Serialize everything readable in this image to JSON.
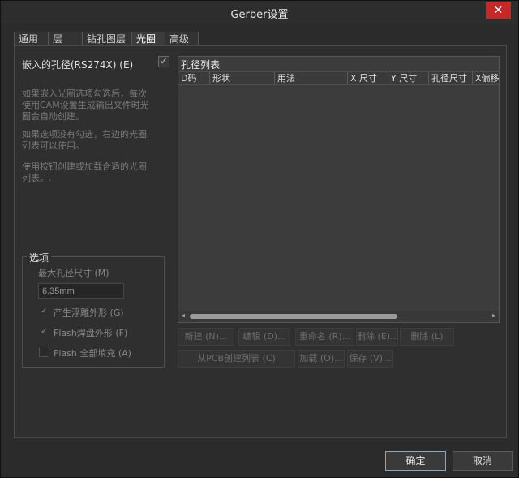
{
  "window": {
    "title": "Gerber设置",
    "close_glyph": "✕"
  },
  "tabs": [
    "通用",
    "层",
    "钻孔图层",
    "光圈",
    "高级"
  ],
  "embed": {
    "label": "嵌入的孔径(RS274X) (E)",
    "checked": true,
    "check_glyph": "✓"
  },
  "descriptions": [
    [
      "如果嵌入光圈选项勾选后，每次",
      "使用CAM设置生成输出文件时光",
      "圈会自动创建。"
    ],
    [
      "如果选项没有勾选，右边的光圈",
      "列表可以使用。"
    ],
    [
      "使用按钮创建或加载合适的光圈",
      "列表。."
    ]
  ],
  "options": {
    "legend": "选项",
    "max_aperture_label": "最大孔径尺寸 (M)",
    "max_aperture_value": "6.35mm",
    "checkboxes": [
      {
        "label": "产生浮雕外形 (G)",
        "checked": true,
        "glyph": "✓"
      },
      {
        "label": "Flash焊盘外形 (F)",
        "checked": true,
        "glyph": "✓"
      },
      {
        "label": "Flash 全部填充 (A)",
        "checked": false,
        "glyph": ""
      }
    ]
  },
  "aperture_table": {
    "title": "孔径列表",
    "columns": [
      "D码",
      "形状",
      "用法",
      "X 尺寸",
      "Y 尺寸",
      "孔径尺寸",
      "X偏移"
    ],
    "rows": [],
    "scroll_left_glyph": "◂",
    "scroll_right_glyph": "▸"
  },
  "buttons": {
    "new": "新建 (N)...",
    "edit": "编辑 (D)...",
    "rename": "重命名 (R)...",
    "delete_e": "删除 (E)...",
    "delete_l": "删除 (L)",
    "create_from_pcb": "从PCB创建列表 (C)",
    "load": "加载 (O)...",
    "save": "保存 (V)..."
  },
  "footer": {
    "ok": "确定",
    "cancel": "取消"
  },
  "colors": {
    "close_button": "#c62828",
    "background": "#2b2b2b",
    "panel": "#2f2f2f",
    "table": "#3c3c3c"
  }
}
